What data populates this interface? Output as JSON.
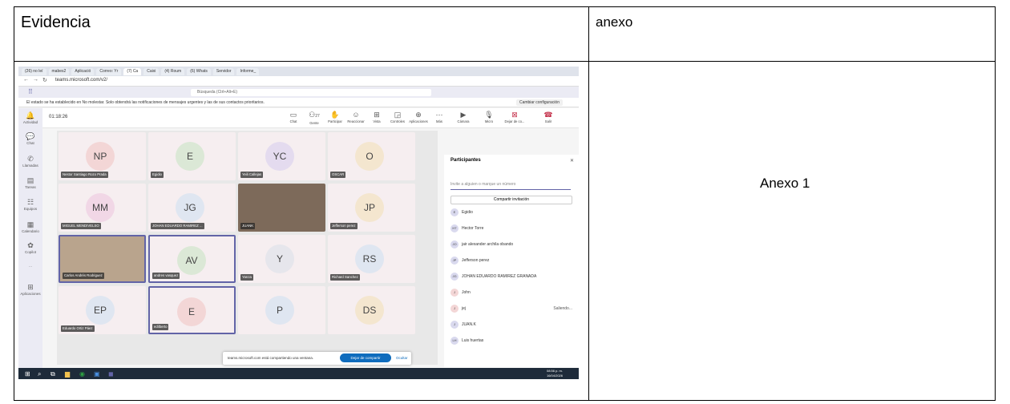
{
  "document": {
    "evidence_header": "Evidencia",
    "annex_header": "anexo",
    "annex_label": "Anexo 1"
  },
  "screenshot": {
    "tabs": [
      "(26) no leí",
      "mabes2",
      "Aplicació",
      "Correo: Yr",
      "(7) Ca",
      "Caixi",
      "(4) Roum",
      "(6) Whats",
      "Servidor",
      "Informe_"
    ],
    "url": "teams.microsoft.com/v2/",
    "search_placeholder": "Búsqueda (Ctrl+Alt+E)",
    "notice": "El estado se ha establecido en No molestar. Solo obtendrá las notificaciones de mensajes urgentes y las de sus contactos prioritarios.",
    "notice_button": "Cambiar configuración",
    "timer": "01:18:26",
    "rail": [
      "Actividad",
      "Chat",
      "Llamadas",
      "Tareas",
      "Equipos",
      "Calendario",
      "Copilot",
      "...",
      "Aplicaciones"
    ],
    "call_controls": [
      "Chat",
      "Gente",
      "Participar",
      "Reaccionar",
      "Vista",
      "Controles",
      "Aplicaciones",
      "Más",
      "Cámara",
      "Micro",
      "Dejar de co...",
      "Salir"
    ],
    "people_count": "27",
    "tiles": [
      {
        "initials": "NP",
        "name": "Nestor Santiago Rozo Prada"
      },
      {
        "initials": "E",
        "name": "Egidio"
      },
      {
        "initials": "YC",
        "name": "Yeili Callejas"
      },
      {
        "initials": "O",
        "name": "OSCAR"
      },
      {
        "initials": "MM",
        "name": "MIGUEL MENDIVELSO"
      },
      {
        "initials": "JG",
        "name": "JOHAN EDUARDO RAMIREZ ..."
      },
      {
        "initials": "",
        "name": "JUANK"
      },
      {
        "initials": "JP",
        "name": "Jefferson perez"
      },
      {
        "initials": "",
        "name": "Carlos Andrés Rodriguez"
      },
      {
        "initials": "AV",
        "name": "andres vasquez"
      },
      {
        "initials": "Y",
        "name": "Yanza"
      },
      {
        "initials": "RS",
        "name": "Richard Sanchez"
      },
      {
        "initials": "EP",
        "name": "Eduardo Ortiz Páez"
      },
      {
        "initials": "E",
        "name": "edilberto"
      },
      {
        "initials": "P",
        "name": ""
      },
      {
        "initials": "DS",
        "name": ""
      }
    ],
    "panel": {
      "title": "Participantes",
      "search_placeholder": "Invite a alguien o marque un número",
      "invite_button": "Compartir invitación",
      "participants": [
        {
          "initials": "E",
          "name": "Egidio",
          "status": ""
        },
        {
          "initials": "HT",
          "name": "Hector Torre",
          "status": ""
        },
        {
          "initials": "JO",
          "name": "jair alexander archila obando",
          "status": ""
        },
        {
          "initials": "JP",
          "name": "Jefferson perez",
          "status": ""
        },
        {
          "initials": "JG",
          "name": "JOHAN EDUARDO RAMIREZ GRANADA",
          "status": ""
        },
        {
          "initials": "J",
          "name": "John",
          "status": ""
        },
        {
          "initials": "J",
          "name": "jej",
          "status": "Saliendo..."
        },
        {
          "initials": "J",
          "name": "JUAN.K",
          "status": ""
        },
        {
          "initials": "LH",
          "name": "Luis huertas",
          "status": ""
        }
      ]
    },
    "share": {
      "text": "teams.microsoft.com está compartiendo una ventana.",
      "stop_button": "Dejar de compartir",
      "hide_link": "Ocultar"
    },
    "clock": {
      "time": "08:56 p. m.",
      "date": "16/04/2026"
    }
  }
}
